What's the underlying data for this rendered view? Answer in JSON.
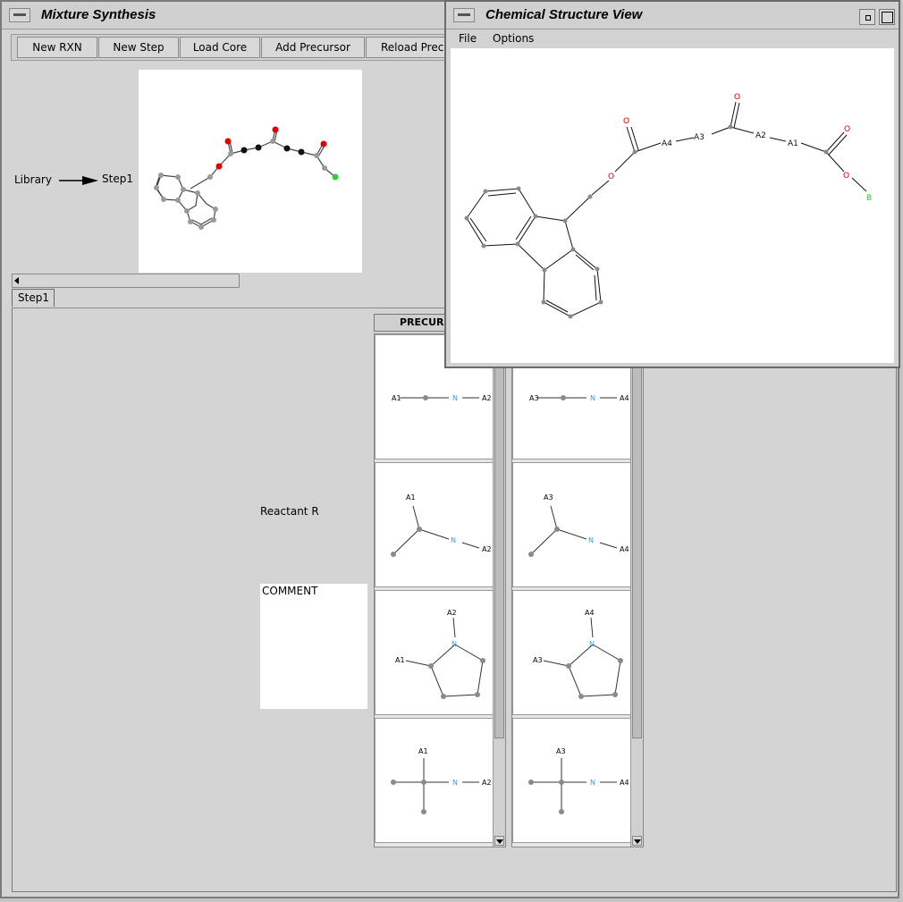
{
  "main_window": {
    "title": "Mixture Synthesis",
    "toolbar": [
      "New RXN",
      "New Step",
      "Load Core",
      "Add Precursor",
      "Reload Precu"
    ],
    "flow": {
      "from": "Library",
      "to": "Step1"
    },
    "tab": "Step1",
    "reactant_label": "Reactant R",
    "comment_label": "COMMENT",
    "precursor_header": "PRECURS",
    "column1_labels": [
      {
        "left": "A1",
        "n": "N",
        "right": "A2"
      },
      {
        "top": "A1",
        "n": "N",
        "right": "A2"
      },
      {
        "top": "A2",
        "left": "A1",
        "n": "N"
      },
      {
        "top": "A1",
        "n": "N",
        "right": "A2"
      }
    ],
    "column2_labels": [
      {
        "left": "A3",
        "n": "N",
        "right": "A4"
      },
      {
        "top": "A3",
        "n": "N",
        "right": "A4"
      },
      {
        "top": "A4",
        "left": "A3",
        "n": "N"
      },
      {
        "top": "A3",
        "n": "N",
        "right": "A4"
      }
    ]
  },
  "structure_window": {
    "title": "Chemical Structure View",
    "menu": [
      "File",
      "Options"
    ],
    "atom_labels": [
      "O",
      "O",
      "A4",
      "A3",
      "O",
      "A2",
      "A1",
      "O",
      "O",
      "B"
    ]
  },
  "colors": {
    "oxygen": "#e00000",
    "nitrogen": "#3a9ad9",
    "boron": "#33cc33",
    "atom": "#8a8a8a"
  }
}
